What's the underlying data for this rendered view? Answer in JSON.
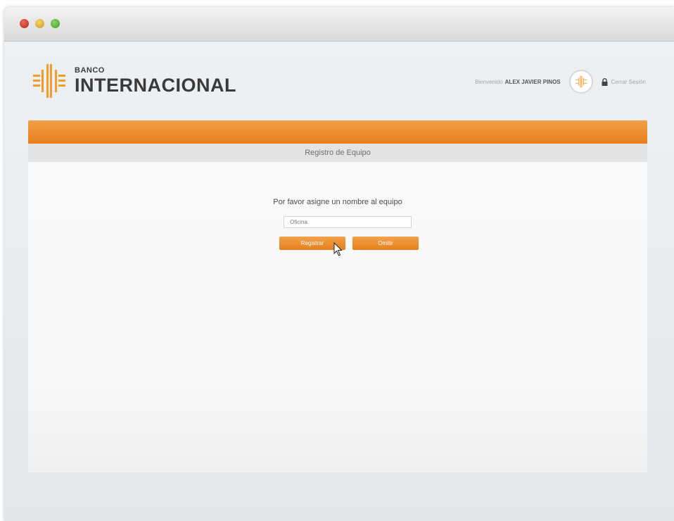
{
  "window": {
    "controls": [
      "close",
      "minimize",
      "maximize"
    ]
  },
  "brand": {
    "small": "BANCO",
    "big": "INTERNACIONAL",
    "color": "#f39c2b"
  },
  "user": {
    "greeting": "Bienvenido",
    "name": "ALEX JAVIER PINOS",
    "logout": "Cerrar Sesión"
  },
  "page": {
    "section_title": "Registro de Equipo",
    "prompt": "Por favor asigne un nombre al equipo",
    "device_name_value": "Oficina",
    "register_label": "Registrar",
    "skip_label": "Omitir"
  },
  "colors": {
    "accent": "#eb8a2a",
    "header_bar": "#e3e3e3"
  },
  "icons": [
    "brand-logo-icon",
    "avatar-logo-icon",
    "lock-icon",
    "cursor-pointer-icon"
  ]
}
